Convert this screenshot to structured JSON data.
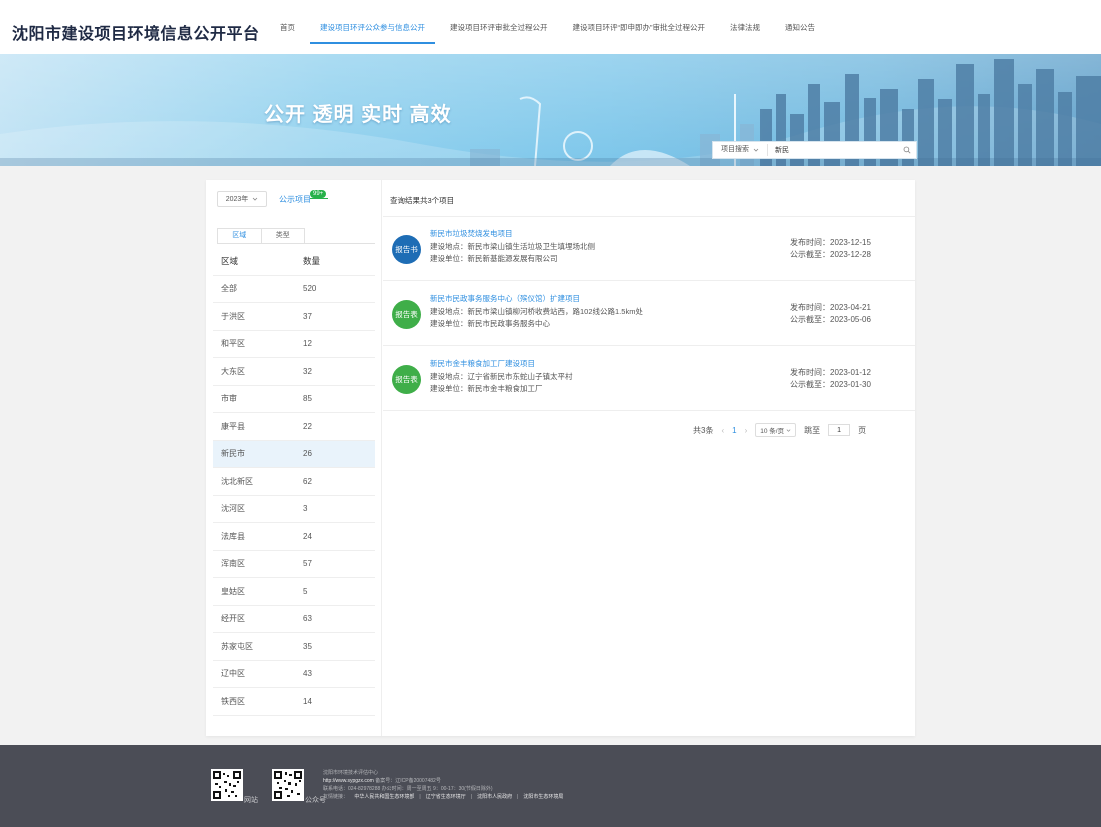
{
  "header": {
    "title": "沈阳市建设项目环境信息公开平台",
    "nav": [
      "首页",
      "建设项目环评公众参与信息公开",
      "建设项目环评审批全过程公开",
      "建设项目环评“即申即办”审批全过程公开",
      "法律法规",
      "通知公告"
    ],
    "active_index": 1
  },
  "banner": {
    "slogan": "公开 透明 实时 高效",
    "search_type": "项目搜索",
    "search_value": "新民"
  },
  "filters": {
    "year": "2023年",
    "pub_label": "公示项目",
    "pub_badge": "99+",
    "tabs": [
      "区域",
      "类型"
    ]
  },
  "region_table": {
    "headers": [
      "区域",
      "数量"
    ],
    "selected": "新民市",
    "rows": [
      {
        "name": "全部",
        "count": "520"
      },
      {
        "name": "于洪区",
        "count": "37"
      },
      {
        "name": "和平区",
        "count": "12"
      },
      {
        "name": "大东区",
        "count": "32"
      },
      {
        "name": "市审",
        "count": "85"
      },
      {
        "name": "康平县",
        "count": "22"
      },
      {
        "name": "新民市",
        "count": "26"
      },
      {
        "name": "沈北新区",
        "count": "62"
      },
      {
        "name": "沈河区",
        "count": "3"
      },
      {
        "name": "法库县",
        "count": "24"
      },
      {
        "name": "浑南区",
        "count": "57"
      },
      {
        "name": "皇姑区",
        "count": "5"
      },
      {
        "name": "经开区",
        "count": "63"
      },
      {
        "name": "苏家屯区",
        "count": "35"
      },
      {
        "name": "辽中区",
        "count": "43"
      },
      {
        "name": "铁西区",
        "count": "14"
      }
    ]
  },
  "results": {
    "summary": "查询结果共3个项目",
    "projects": [
      {
        "badge": "报告书",
        "badge_color": "#1e6db5",
        "title": "新民市垃圾焚烧发电项目",
        "location": "建设地点：新民市梁山镇生活垃圾卫生填埋场北侧",
        "builder": "建设单位：新民新基能源发展有限公司",
        "publish": "发布时间：2023-12-15",
        "deadline": "公示截至：2023-12-28"
      },
      {
        "badge": "报告表",
        "badge_color": "#3fae49",
        "title": "新民市民政事务服务中心（殡仪馆）扩建项目",
        "location": "建设地点：新民市梁山镇柳河桥收费站西，路102线公路1.5km处",
        "builder": "建设单位：新民市民政事务服务中心",
        "publish": "发布时间：2023-04-21",
        "deadline": "公示截至：2023-05-06"
      },
      {
        "badge": "报告表",
        "badge_color": "#3fae49",
        "title": "新民市金丰粮食加工厂建设项目",
        "location": "建设地点：辽宁省新民市东蛇山子镇太平村",
        "builder": "建设单位：新民市金丰粮食加工厂",
        "publish": "发布时间：2023-01-12",
        "deadline": "公示截至：2023-01-30"
      }
    ]
  },
  "pager": {
    "total": "共3条",
    "current": "1",
    "page_size": "10 条/页",
    "jump_label": "跳至",
    "jump_value": "1",
    "page_unit": "页"
  },
  "footer": {
    "qr1_label": "网站",
    "qr2_label": "公众号",
    "org": "沈阳市环境技术评估中心",
    "site": "http://www.sypgzx.com",
    "icp": "备案号：辽ICP备20007482号",
    "contact": "联系电话：024-82978288 办公时间：周一至周五 9：00-17：30(节假日除外)",
    "links_label": "友情链接：",
    "links": [
      "中华人民共和国生态环境部",
      "辽宁省生态环境厅",
      "沈阳市人民政府",
      "沈阳市生态环境局"
    ]
  }
}
